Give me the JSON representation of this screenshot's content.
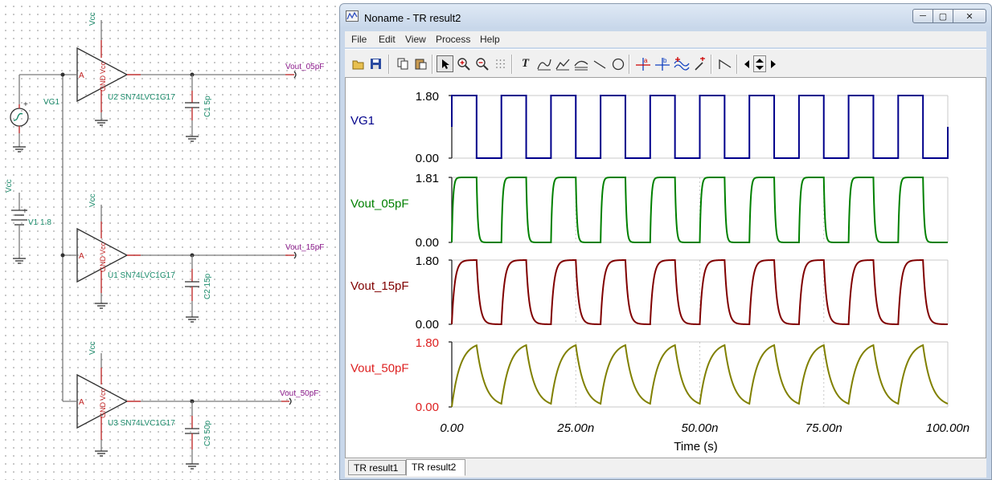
{
  "window": {
    "title": "Noname - TR result2",
    "controls": {
      "minimize": "─",
      "maximize": "▢",
      "close": "✕"
    }
  },
  "menu": [
    "File",
    "Edit",
    "View",
    "Process",
    "Help"
  ],
  "toolbar_icons": [
    "open-icon",
    "save-icon",
    "copy-icon",
    "paste-icon",
    "pointer-icon",
    "zoom-in-icon",
    "zoom-out-icon",
    "grid-icon",
    "text-icon",
    "curve-tool-1-icon",
    "curve-tool-2-icon",
    "curve-tool-3-icon",
    "line-icon",
    "circle-icon",
    "cursor-a-icon",
    "cursor-b-icon",
    "wave-icon",
    "marker-icon",
    "step-icon",
    "arrow-left-icon",
    "arrow-updown-icon",
    "arrow-right-icon"
  ],
  "tabs": [
    "TR result1",
    "TR result2"
  ],
  "active_tab": 1,
  "schematic": {
    "source": "VG1",
    "supply_label": "Vcc",
    "battery": "V1 1.8",
    "gates": [
      {
        "name": "U2 SN74LVC1G17",
        "cap": "C1 5p",
        "out": "Vout_05pF"
      },
      {
        "name": "U1 SN74LVC1G17",
        "cap": "C2 15p",
        "out": "Vout_15pF"
      },
      {
        "name": "U3 SN74LVC1G17",
        "cap": "C3 50p",
        "out": "Vout_50pF:"
      }
    ],
    "pin_labels": {
      "input": "A",
      "gnd": "GND",
      "vcc": "Vcc"
    },
    "plus": "+"
  },
  "colors": {
    "vg1": "#00008b",
    "vout_05pf": "#008000",
    "vout_15pf": "#800000",
    "vout_50pf": "#808000",
    "label_50pf": "#dd2020"
  },
  "chart_data": {
    "type": "line",
    "xlabel": "Time (s)",
    "xlim": [
      0,
      100
    ],
    "x_unit": "ns",
    "x_ticks": [
      "0.00",
      "25.00n",
      "50.00n",
      "75.00n",
      "100.00n"
    ],
    "period_ns": 10,
    "duty": 0.5,
    "series": [
      {
        "name": "VG1",
        "ymin_label": "0.00",
        "ymax_label": "1.80",
        "ylim": [
          0,
          1.8
        ],
        "tau_ns": 0,
        "color_key": "vg1"
      },
      {
        "name": "Vout_05pF",
        "ymin_label": "0.00",
        "ymax_label": "1.81",
        "ylim": [
          0,
          1.81
        ],
        "tau_ns": 0.25,
        "color_key": "vout_05pf"
      },
      {
        "name": "Vout_15pF",
        "ymin_label": "0.00",
        "ymax_label": "1.80",
        "ylim": [
          0,
          1.8
        ],
        "tau_ns": 0.6,
        "color_key": "vout_15pf"
      },
      {
        "name": "Vout_50pF",
        "ymin_label": "0.00",
        "ymax_label": "1.80",
        "ylim": [
          0,
          1.8
        ],
        "tau_ns": 1.7,
        "color_key": "vout_50pf"
      }
    ]
  }
}
